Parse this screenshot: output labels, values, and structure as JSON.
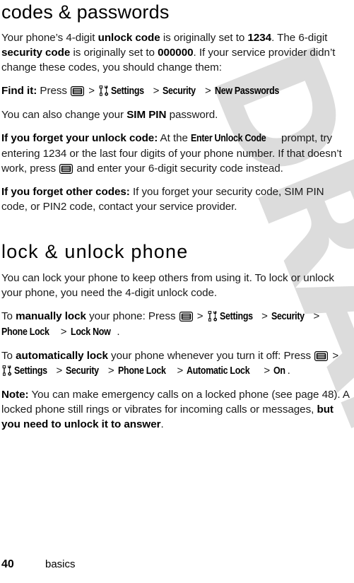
{
  "document": {
    "watermark_text": "DRAFT",
    "watermark_color": "#dcdcdc"
  },
  "sections": [
    {
      "title": "codes & passwords",
      "paragraphs": [
        {
          "id": "intro",
          "runs": [
            {
              "t": "Your phone’s 4-digit ",
              "s": "normal"
            },
            {
              "t": "unlock code",
              "s": "bold"
            },
            {
              "t": " is originally set to ",
              "s": "normal"
            },
            {
              "t": "1234",
              "s": "bold"
            },
            {
              "t": ". The 6-digit ",
              "s": "normal"
            },
            {
              "t": "security code",
              "s": "bold"
            },
            {
              "t": " is originally set to ",
              "s": "normal"
            },
            {
              "t": "000000",
              "s": "bold"
            },
            {
              "t": ". If your service provider didn’t change these codes, you should change them:",
              "s": "normal"
            }
          ]
        },
        {
          "id": "find-it",
          "runs": [
            {
              "t": "Find it:",
              "s": "bold"
            },
            {
              "t": " Press ",
              "s": "normal"
            },
            {
              "t": "",
              "s": "icon-menu"
            },
            {
              "t": ">",
              "s": "sep"
            },
            {
              "t": "",
              "s": "icon-tools"
            },
            {
              "t": "Settings",
              "s": "menu"
            },
            {
              "t": ">",
              "s": "sep"
            },
            {
              "t": "Security",
              "s": "menu"
            },
            {
              "t": ">",
              "s": "sep"
            },
            {
              "t": "New Passwords",
              "s": "menu"
            }
          ]
        },
        {
          "id": "sim-pin",
          "runs": [
            {
              "t": "You can also change your ",
              "s": "normal"
            },
            {
              "t": "SIM PIN",
              "s": "bold"
            },
            {
              "t": " password.",
              "s": "normal"
            }
          ]
        },
        {
          "id": "forgot-unlock",
          "runs": [
            {
              "t": "If you forget your unlock code:",
              "s": "bold"
            },
            {
              "t": " At the ",
              "s": "normal"
            },
            {
              "t": "Enter Unlock Code",
              "s": "menu"
            },
            {
              "t": " prompt, try entering 1234 or the last four digits of your phone number. If that doesn’t work, press ",
              "s": "normal"
            },
            {
              "t": "",
              "s": "icon-menu"
            },
            {
              "t": " and enter your 6-digit security code instead.",
              "s": "normal"
            }
          ]
        },
        {
          "id": "forgot-other",
          "runs": [
            {
              "t": "If you forget other codes:",
              "s": "bold"
            },
            {
              "t": " If you forget your security code, SIM PIN code, or PIN2 code, contact your service provider.",
              "s": "normal"
            }
          ]
        }
      ]
    },
    {
      "title": "lock & unlock phone",
      "paragraphs": [
        {
          "id": "lock-intro",
          "runs": [
            {
              "t": "You can lock your phone to keep others from using it. To lock or unlock your phone, you need the 4-digit unlock code.",
              "s": "normal"
            }
          ]
        },
        {
          "id": "manual-lock",
          "runs": [
            {
              "t": "To ",
              "s": "normal"
            },
            {
              "t": "manually lock",
              "s": "bold"
            },
            {
              "t": " your phone: Press ",
              "s": "normal"
            },
            {
              "t": "",
              "s": "icon-menu"
            },
            {
              "t": ">",
              "s": "sep"
            },
            {
              "t": "",
              "s": "icon-tools"
            },
            {
              "t": "Settings",
              "s": "menu"
            },
            {
              "t": ">",
              "s": "sep"
            },
            {
              "t": "Security",
              "s": "menu"
            },
            {
              "t": ">",
              "s": "sep"
            },
            {
              "t": "Phone Lock",
              "s": "menu"
            },
            {
              "t": ">",
              "s": "sep"
            },
            {
              "t": "Lock Now",
              "s": "menu"
            },
            {
              "t": ".",
              "s": "normal"
            }
          ]
        },
        {
          "id": "auto-lock",
          "runs": [
            {
              "t": "To ",
              "s": "normal"
            },
            {
              "t": "automatically lock",
              "s": "bold"
            },
            {
              "t": " your phone whenever you turn it off: Press ",
              "s": "normal"
            },
            {
              "t": "",
              "s": "icon-menu"
            },
            {
              "t": ">",
              "s": "sep"
            },
            {
              "t": "",
              "s": "icon-tools"
            },
            {
              "t": "Settings",
              "s": "menu"
            },
            {
              "t": ">",
              "s": "sep"
            },
            {
              "t": "Security",
              "s": "menu"
            },
            {
              "t": ">",
              "s": "sep"
            },
            {
              "t": "Phone Lock",
              "s": "menu"
            },
            {
              "t": ">",
              "s": "sep"
            },
            {
              "t": "Automatic Lock",
              "s": "menu"
            },
            {
              "t": ">",
              "s": "sep"
            },
            {
              "t": "On",
              "s": "menu"
            },
            {
              "t": ".",
              "s": "normal"
            }
          ]
        },
        {
          "id": "note",
          "runs": [
            {
              "t": "Note:",
              "s": "bold"
            },
            {
              "t": " You can make emergency calls on a locked phone (see page 48). A locked phone still rings or vibrates for incoming calls or messages, ",
              "s": "normal"
            },
            {
              "t": "but you need to unlock it to answer",
              "s": "bold"
            },
            {
              "t": ".",
              "s": "normal"
            }
          ]
        }
      ]
    }
  ],
  "footer": {
    "page_number": "40",
    "label": "basics"
  },
  "icons": {
    "menu_key": "menu-key-icon",
    "tools": "settings-tools-icon"
  }
}
